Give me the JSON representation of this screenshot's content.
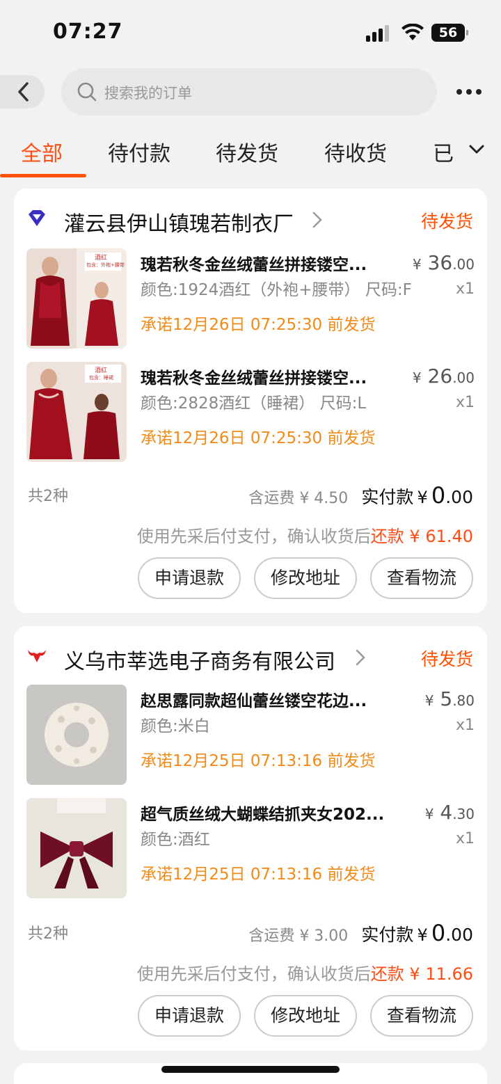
{
  "status_bar": {
    "time": "07:27",
    "battery": "56"
  },
  "search": {
    "placeholder": "搜索我的订单"
  },
  "tabs": [
    "全部",
    "待付款",
    "待发货",
    "待收货",
    "已"
  ],
  "active_tab": "全部",
  "colors": {
    "accent": "#ff5000",
    "promise": "#f28a1a",
    "card_bg": "#ffffff",
    "page_bg": "#f2f2f2"
  },
  "orders": [
    {
      "shop_icon": "diamond-shop-icon",
      "shop_name": "灌云县伊山镇瑰若制衣厂",
      "status": "待发货",
      "items": [
        {
          "title": "瑰若秋冬金丝绒蕾丝拼接镂空...",
          "spec": "颜色:1924酒红（外袍+腰带） 尺码:F",
          "promise": "承诺12月26日 07:25:30 前发货",
          "price_currency": "¥",
          "price_int": "36",
          "price_dec": ".00",
          "qty": "x1",
          "thumb_labels": [
            "酒红",
            "包含：外袍+腰带"
          ]
        },
        {
          "title": "瑰若秋冬金丝绒蕾丝拼接镂空...",
          "spec": "颜色:2828酒红（睡裙） 尺码:L",
          "promise": "承诺12月26日 07:25:30 前发货",
          "price_currency": "¥",
          "price_int": "26",
          "price_dec": ".00",
          "qty": "x1",
          "thumb_labels": [
            "酒红",
            "包含：睡裙"
          ]
        }
      ],
      "count": "共2种",
      "shipping": "含运费 ¥ 4.50",
      "paid_label": "实付款",
      "paid_currency": "¥",
      "paid_int": "0",
      "paid_dec": ".00",
      "repay_text": "使用先采后付支付，确认收货后",
      "repay_highlight": "还款 ¥ 61.40",
      "buttons": [
        "申请退款",
        "修改地址",
        "查看物流"
      ]
    },
    {
      "shop_icon": "bull-shop-icon",
      "shop_name": "义乌市莘选电子商务有限公司",
      "status": "待发货",
      "items": [
        {
          "title": "赵思露同款超仙蕾丝镂空花边...",
          "spec": "颜色:米白",
          "promise": "承诺12月25日 07:13:16 前发货",
          "price_currency": "¥",
          "price_int": "5",
          "price_dec": ".80",
          "qty": "x1"
        },
        {
          "title": "超气质丝绒大蝴蝶结抓夹女202...",
          "spec": "颜色:酒红",
          "promise": "承诺12月25日 07:13:16 前发货",
          "price_currency": "¥",
          "price_int": "4",
          "price_dec": ".30",
          "qty": "x1"
        }
      ],
      "count": "共2种",
      "shipping": "含运费 ¥ 3.00",
      "paid_label": "实付款",
      "paid_currency": "¥",
      "paid_int": "0",
      "paid_dec": ".00",
      "repay_text": "使用先采后付支付，确认收货后",
      "repay_highlight": "还款 ¥ 11.66",
      "buttons": [
        "申请退款",
        "修改地址",
        "查看物流"
      ]
    }
  ]
}
